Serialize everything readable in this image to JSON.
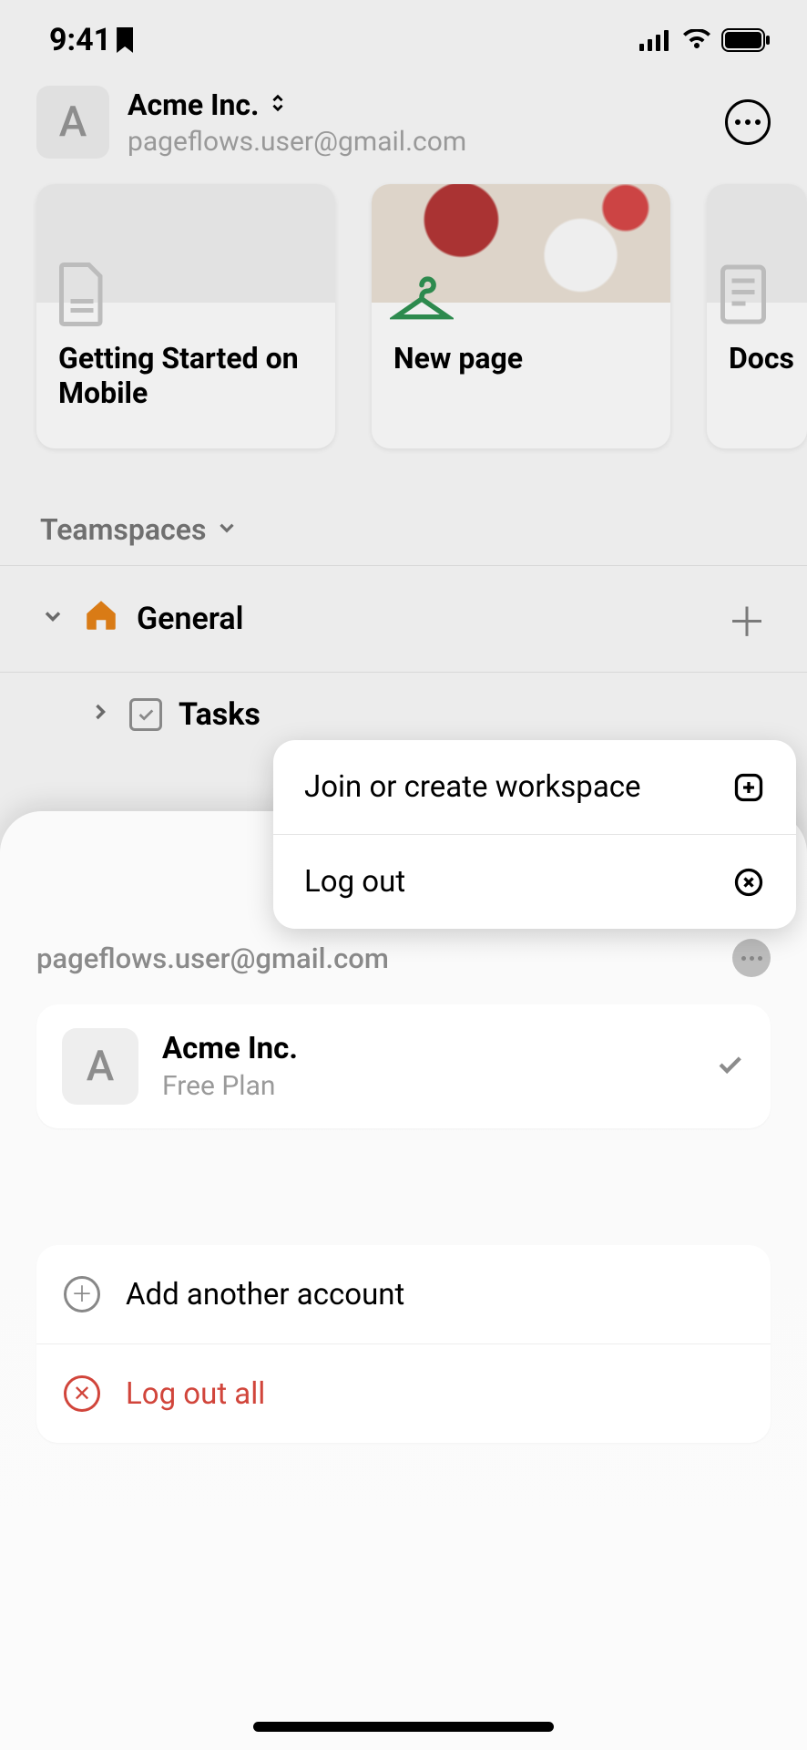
{
  "status": {
    "time": "9:41"
  },
  "header": {
    "workspace_initial": "A",
    "workspace_name": "Acme Inc.",
    "email": "pageflows.user@gmail.com"
  },
  "cards": [
    {
      "title": "Getting Started on Mobile"
    },
    {
      "title": "New page"
    },
    {
      "title": "Docs"
    }
  ],
  "sections": {
    "teamspaces_label": "Teamspaces"
  },
  "teamspace": {
    "general_label": "General",
    "tasks_label": "Tasks"
  },
  "popup": {
    "join_label": "Join or create workspace",
    "logout_label": "Log out"
  },
  "sheet": {
    "email": "pageflows.user@gmail.com",
    "workspace": {
      "initial": "A",
      "name": "Acme Inc.",
      "plan": "Free Plan"
    },
    "add_account_label": "Add another account",
    "logout_all_label": "Log out all"
  }
}
